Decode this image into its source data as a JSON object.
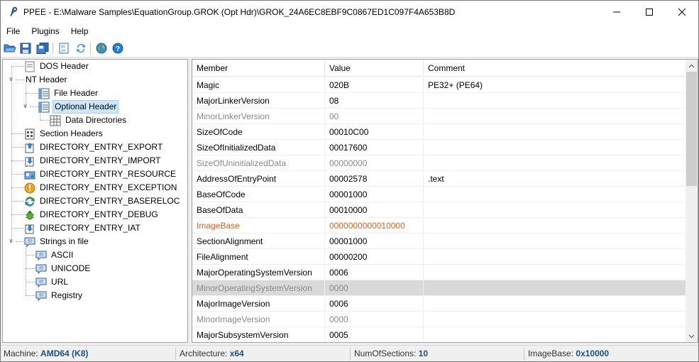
{
  "window": {
    "title": "PPEE - E:\\Malware Samples\\EquationGroup.GROK (Opt Hdr)\\GROK_24A6EC8EBF9C0867ED1C097F4A653B8D"
  },
  "menu": [
    "File",
    "Plugins",
    "Help"
  ],
  "toolbar": {
    "buttons": [
      "open-folder-icon",
      "save-icon",
      "save-all-icon",
      "hex-view-icon",
      "refresh-icon",
      "globe-icon",
      "help-icon"
    ]
  },
  "tree": {
    "items": [
      {
        "label": "DOS Header",
        "icon": "header-icon"
      },
      {
        "label": "NT Header",
        "icon": "none"
      },
      {
        "label": "File Header",
        "icon": "table-icon"
      },
      {
        "label": "Optional Header",
        "icon": "table-icon"
      },
      {
        "label": "Data Directories",
        "icon": "grid-icon"
      },
      {
        "label": "Section Headers",
        "icon": "section-icon"
      },
      {
        "label": "DIRECTORY_ENTRY_EXPORT",
        "icon": "export-icon"
      },
      {
        "label": "DIRECTORY_ENTRY_IMPORT",
        "icon": "import-icon"
      },
      {
        "label": "DIRECTORY_ENTRY_RESOURCE",
        "icon": "resource-icon"
      },
      {
        "label": "DIRECTORY_ENTRY_EXCEPTION",
        "icon": "exception-icon"
      },
      {
        "label": "DIRECTORY_ENTRY_BASERELOC",
        "icon": "reloc-icon"
      },
      {
        "label": "DIRECTORY_ENTRY_DEBUG",
        "icon": "bug-icon"
      },
      {
        "label": "DIRECTORY_ENTRY_IAT",
        "icon": "import-icon"
      },
      {
        "label": "Strings in file",
        "icon": "strings-icon"
      },
      {
        "label": "ASCII",
        "icon": "strings-icon"
      },
      {
        "label": "UNICODE",
        "icon": "strings-icon"
      },
      {
        "label": "URL",
        "icon": "strings-icon"
      },
      {
        "label": "Registry",
        "icon": "strings-icon"
      }
    ],
    "selected": "Optional Header"
  },
  "grid": {
    "columns": [
      "Member",
      "Value",
      "Comment"
    ],
    "rows": [
      {
        "member": "Magic",
        "value": "020B",
        "comment": "PE32+ (PE64)",
        "state": "normal"
      },
      {
        "member": "MajorLinkerVersion",
        "value": "08",
        "comment": "",
        "state": "normal"
      },
      {
        "member": "MinorLinkerVersion",
        "value": "00",
        "comment": "",
        "state": "dim"
      },
      {
        "member": "SizeOfCode",
        "value": "00010C00",
        "comment": "",
        "state": "normal"
      },
      {
        "member": "SizeOfInitializedData",
        "value": "00017600",
        "comment": "",
        "state": "normal"
      },
      {
        "member": "SizeOfUninitializedData",
        "value": "00000000",
        "comment": "",
        "state": "dim"
      },
      {
        "member": "AddressOfEntryPoint",
        "value": "00002578",
        "comment": ".text",
        "state": "normal"
      },
      {
        "member": "BaseOfCode",
        "value": "00001000",
        "comment": "",
        "state": "normal"
      },
      {
        "member": "BaseOfData",
        "value": "00010000",
        "comment": "",
        "state": "normal"
      },
      {
        "member": "ImageBase",
        "value": "0000000000010000",
        "comment": "",
        "state": "mod"
      },
      {
        "member": "SectionAlignment",
        "value": "00001000",
        "comment": "",
        "state": "normal"
      },
      {
        "member": "FileAlignment",
        "value": "00000200",
        "comment": "",
        "state": "normal"
      },
      {
        "member": "MajorOperatingSystemVersion",
        "value": "0006",
        "comment": "",
        "state": "normal"
      },
      {
        "member": "MinorOperatingSystemVersion",
        "value": "0000",
        "comment": "",
        "state": "dim-hl"
      },
      {
        "member": "MajorImageVersion",
        "value": "0006",
        "comment": "",
        "state": "normal"
      },
      {
        "member": "MinorImageVersion",
        "value": "0000",
        "comment": "",
        "state": "dim"
      },
      {
        "member": "MajorSubsystemVersion",
        "value": "0005",
        "comment": "",
        "state": "normal"
      }
    ]
  },
  "status": {
    "machine_label": "Machine:",
    "machine_value": "AMD64 (K8)",
    "arch_label": "Architecture:",
    "arch_value": "x64",
    "sections_label": "NumOfSections:",
    "sections_value": "10",
    "imagebase_label": "ImageBase:",
    "imagebase_value": "0x10000"
  },
  "colors": {
    "modified": "#e8601c",
    "status_value": "#1a4f8a",
    "selection": "#cce8ff"
  }
}
